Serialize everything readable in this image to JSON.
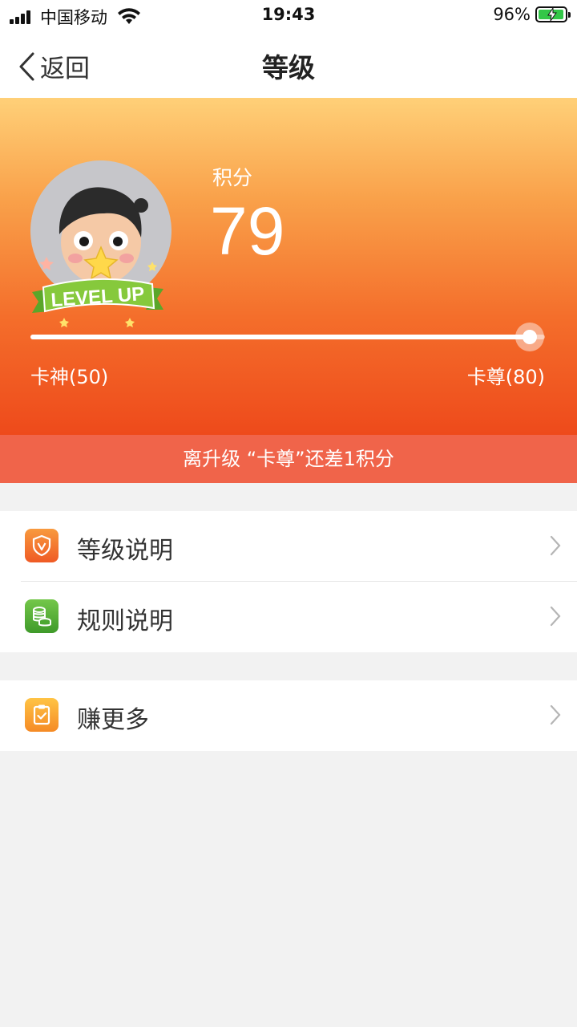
{
  "status_bar": {
    "carrier": "中国移动",
    "time": "19:43",
    "battery_percent": "96%",
    "battery_level": 0.96
  },
  "nav": {
    "back_label": "返回",
    "title": "等级"
  },
  "hero": {
    "score_label": "积分",
    "score_value": "79",
    "level_badge_text": "LEVEL UP",
    "current_level": "卡神(50)",
    "next_level": "卡尊(80)",
    "progress_fraction": 0.97
  },
  "banner": {
    "text": "离升级 “卡尊”还差1积分"
  },
  "menu": {
    "items": [
      {
        "label": "等级说明",
        "icon": "shield-icon",
        "color": "#f26a2c"
      },
      {
        "label": "规则说明",
        "icon": "coins-icon",
        "color": "#55b13a"
      },
      {
        "label": "赚更多",
        "icon": "clipboard-check-icon",
        "color": "#f7a52f"
      }
    ]
  }
}
